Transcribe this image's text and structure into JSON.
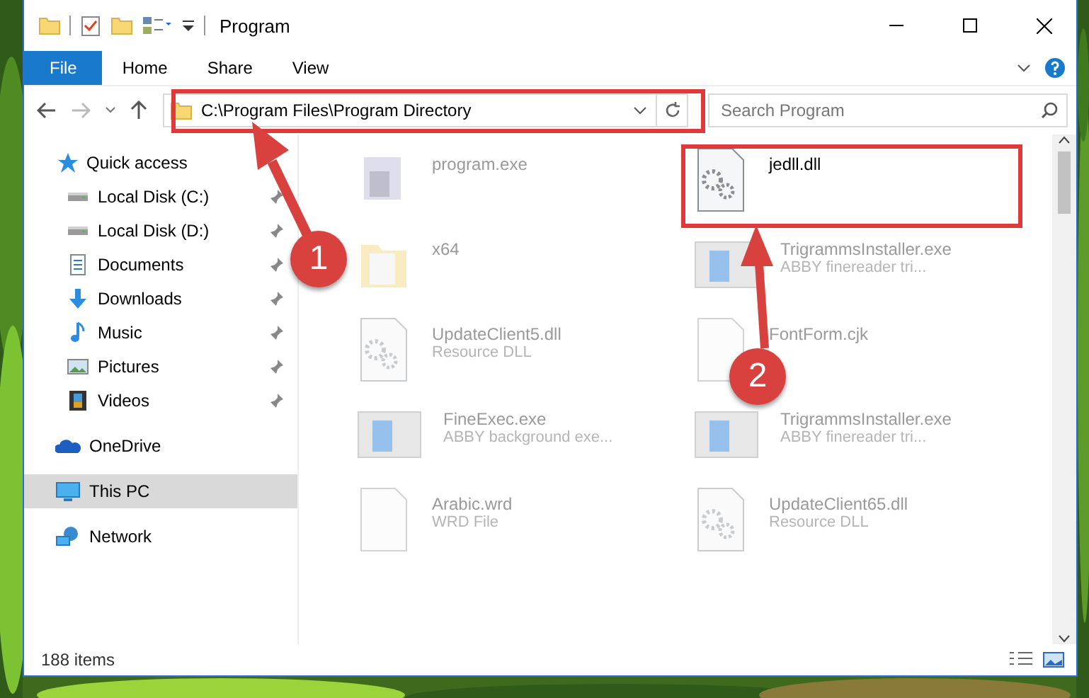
{
  "window": {
    "title": "Program"
  },
  "ribbon_tabs": [
    {
      "label": "File",
      "selected": true
    },
    {
      "label": "Home",
      "selected": false
    },
    {
      "label": "Share",
      "selected": false
    },
    {
      "label": "View",
      "selected": false
    }
  ],
  "address": {
    "path": "C:\\Program Files\\Program Directory"
  },
  "search": {
    "placeholder": "Search Program"
  },
  "sidebar": {
    "items": [
      {
        "label": "Quick access",
        "kind": "star",
        "pinned": false,
        "selected": false,
        "children": [
          {
            "label": "Local Disk (C:)",
            "kind": "disk",
            "pinned": true,
            "selected": false
          },
          {
            "label": "Local Disk (D:)",
            "kind": "disk",
            "pinned": true,
            "selected": false
          },
          {
            "label": "Documents",
            "kind": "document",
            "pinned": true,
            "selected": false
          },
          {
            "label": "Downloads",
            "kind": "download",
            "pinned": true,
            "selected": false
          },
          {
            "label": "Music",
            "kind": "music",
            "pinned": true,
            "selected": false
          },
          {
            "label": "Pictures",
            "kind": "pictures",
            "pinned": true,
            "selected": false
          },
          {
            "label": "Videos",
            "kind": "video",
            "pinned": true,
            "selected": false
          }
        ]
      },
      {
        "label": "OneDrive",
        "kind": "cloud",
        "pinned": false,
        "selected": false
      },
      {
        "label": "This PC",
        "kind": "pc",
        "pinned": false,
        "selected": true
      },
      {
        "label": "Network",
        "kind": "network",
        "pinned": false,
        "selected": false
      }
    ]
  },
  "files": [
    {
      "name": "program.exe",
      "kind": "exe",
      "sharp": false
    },
    {
      "name": "jedll.dll",
      "kind": "dll",
      "sharp": true
    },
    {
      "name": "x64",
      "kind": "folder",
      "sharp": false
    },
    {
      "name": "TrigrammsInstaller.exe",
      "detail": "ABBY finereader tri...",
      "kind": "app",
      "sharp": false
    },
    {
      "name": "UpdateClient5.dll",
      "detail": "Resource DLL",
      "kind": "dll",
      "sharp": false
    },
    {
      "name": "FontForm.cjk",
      "kind": "file",
      "sharp": false
    },
    {
      "name": "FineExec.exe",
      "detail": "ABBY background exe...",
      "kind": "app",
      "sharp": false
    },
    {
      "name": "TrigrammsInstaller.exe",
      "detail": "ABBY finereader tri...",
      "kind": "app",
      "sharp": false
    },
    {
      "name": "Arabic.wrd",
      "detail": "WRD File",
      "kind": "file",
      "sharp": false
    },
    {
      "name": "UpdateClient65.dll",
      "detail": "Resource DLL",
      "kind": "dll",
      "sharp": false
    }
  ],
  "status_bar": {
    "count": "188 items"
  },
  "annotations": [
    {
      "label": "1"
    },
    {
      "label": "2"
    }
  ]
}
